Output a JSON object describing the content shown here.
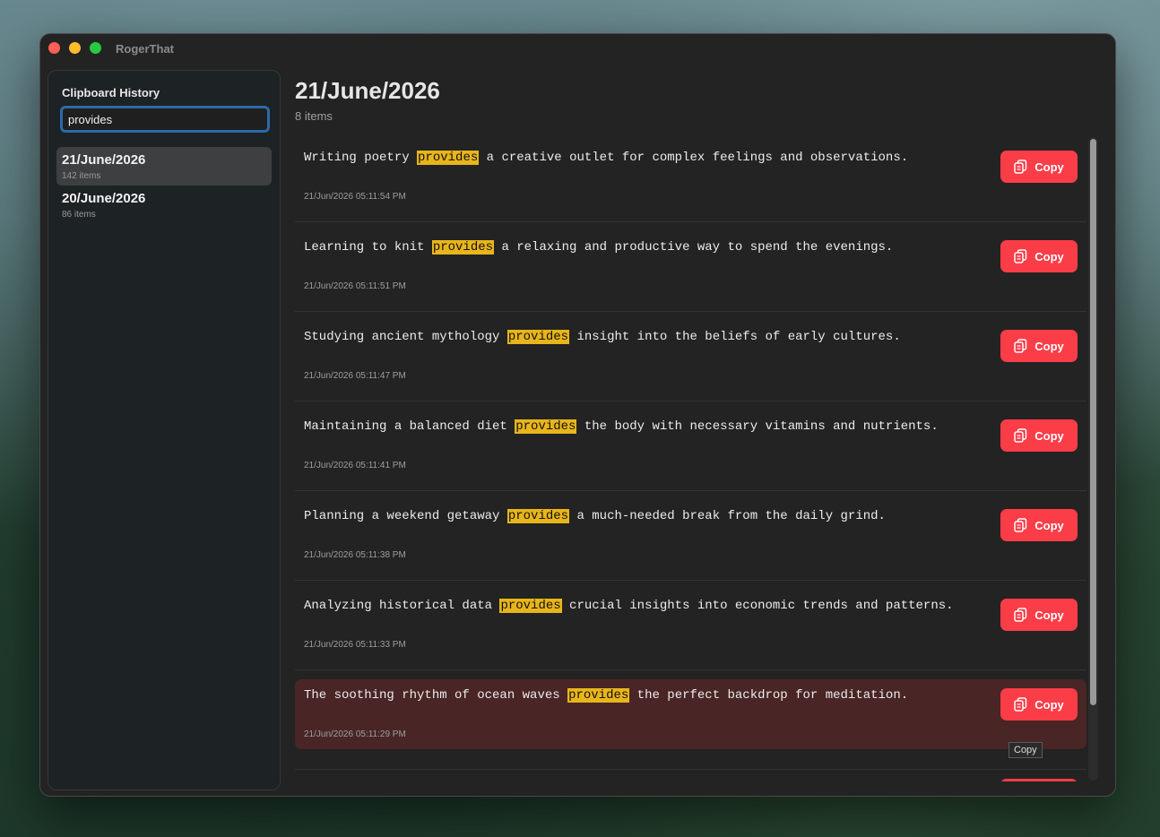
{
  "app": {
    "title": "RogerThat"
  },
  "sidebar": {
    "title": "Clipboard History",
    "search_value": "provides",
    "groups": [
      {
        "date": "21/June/2026",
        "count": "142 items"
      },
      {
        "date": "20/June/2026",
        "count": "86 items"
      }
    ]
  },
  "main": {
    "title": "21/June/2026",
    "subtitle": "8 items",
    "highlight_term": "provides",
    "copy_label": "Copy",
    "tooltip": "Copy",
    "items": [
      {
        "before": "Writing poetry ",
        "after": " a creative outlet for complex feelings and observations.",
        "time": "21/Jun/2026 05:11:54 PM"
      },
      {
        "before": "Learning to knit ",
        "after": " a relaxing and productive way to spend the evenings.",
        "time": "21/Jun/2026 05:11:51 PM"
      },
      {
        "before": "Studying ancient mythology ",
        "after": " insight into the beliefs of early cultures.",
        "time": "21/Jun/2026 05:11:47 PM"
      },
      {
        "before": "Maintaining a balanced diet ",
        "after": " the body with necessary vitamins and nutrients.",
        "time": "21/Jun/2026 05:11:41 PM"
      },
      {
        "before": "Planning a weekend getaway ",
        "after": " a much-needed break from the daily grind.",
        "time": "21/Jun/2026 05:11:38 PM"
      },
      {
        "before": "Analyzing historical data ",
        "after": " crucial insights into economic trends and patterns.",
        "time": "21/Jun/2026 05:11:33 PM"
      },
      {
        "before": "The soothing rhythm of ocean waves ",
        "after": " the perfect backdrop for meditation.",
        "time": "21/Jun/2026 05:11:29 PM"
      }
    ]
  },
  "colors": {
    "accent": "#fb3d48",
    "highlight": "#e8b51a",
    "selected_row": "#492526",
    "focus_ring": "#2c6aa8"
  }
}
